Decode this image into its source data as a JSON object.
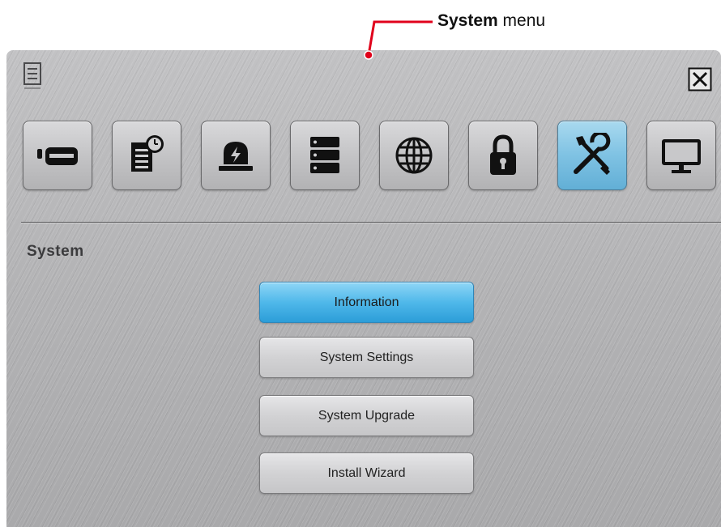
{
  "annotation": {
    "bold": "System",
    "rest": " menu"
  },
  "window": {
    "close_symbol": "✕"
  },
  "toolbar": {
    "items": [
      {
        "icon": "camera-icon",
        "active": false
      },
      {
        "icon": "record-schedule-icon",
        "active": false
      },
      {
        "icon": "alarm-icon",
        "active": false
      },
      {
        "icon": "storage-icon",
        "active": false
      },
      {
        "icon": "network-globe-icon",
        "active": false
      },
      {
        "icon": "lock-icon",
        "active": false
      },
      {
        "icon": "tools-icon",
        "active": true
      },
      {
        "icon": "display-monitor-icon",
        "active": false
      }
    ],
    "active_color": "#62afd6"
  },
  "section": {
    "title": "System"
  },
  "menu": [
    {
      "label": "Information",
      "selected": true
    },
    {
      "label": "System Settings",
      "selected": false
    },
    {
      "label": "System Upgrade",
      "selected": false
    },
    {
      "label": "Install Wizard",
      "selected": false
    }
  ],
  "colors": {
    "callout": "#e0001b",
    "selected_button": "#4fb8ea"
  }
}
